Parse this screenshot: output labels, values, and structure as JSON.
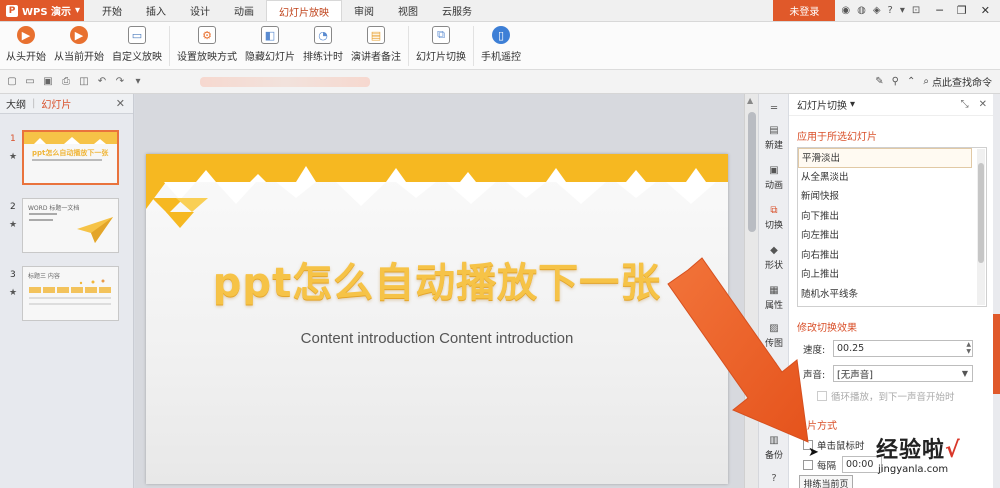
{
  "titlebar": {
    "app_name": "WPS 演示",
    "tabs": [
      "开始",
      "插入",
      "设计",
      "动画",
      "幻灯片放映",
      "审阅",
      "视图",
      "云服务"
    ],
    "active_tab": 4,
    "login_label": "未登录"
  },
  "ribbon": {
    "buttons": [
      {
        "label": "从头开始",
        "icon": "play-icon",
        "color": "#e8702f"
      },
      {
        "label": "从当前开始",
        "icon": "play-current-icon",
        "color": "#e8702f"
      },
      {
        "label": "自定义放映",
        "icon": "custom-show-icon",
        "color": "#4b7bbd"
      },
      {
        "label": "设置放映方式",
        "icon": "settings-icon",
        "color": "#7a7a7a"
      },
      {
        "label": "隐藏幻灯片",
        "icon": "hide-slide-icon",
        "color": "#5a8bd0"
      },
      {
        "label": "排练计时",
        "icon": "rehearse-timing-icon",
        "color": "#5a8bd0"
      },
      {
        "label": "演讲者备注",
        "icon": "speaker-notes-icon",
        "color": "#e8a02f"
      },
      {
        "label": "幻灯片切换",
        "icon": "slide-transition-icon",
        "color": "#5a8bd0"
      },
      {
        "label": "手机遥控",
        "icon": "phone-remote-icon",
        "color": "#3d7fd6"
      }
    ]
  },
  "quickbar": {
    "search_label": "点此查找命令"
  },
  "leftpane": {
    "tab_outline": "大纲",
    "tab_slides": "幻灯片",
    "slides": [
      {
        "num": "1",
        "star": "★",
        "title": "ppt怎么自动播放下一张"
      },
      {
        "num": "2",
        "star": "★",
        "title": "WORD 标题一文档"
      },
      {
        "num": "3",
        "star": "★",
        "title": "标题三 内容"
      }
    ]
  },
  "slide": {
    "title": "ppt怎么自动播放下一张",
    "subtitle": "Content introduction Content introduction"
  },
  "toolstrip": [
    {
      "label": "新建",
      "icon": "new-icon"
    },
    {
      "label": "动画",
      "icon": "animation-icon"
    },
    {
      "label": "切换",
      "icon": "transition-icon"
    },
    {
      "label": "形状",
      "icon": "shape-icon"
    },
    {
      "label": "属性",
      "icon": "properties-icon"
    },
    {
      "label": "传图",
      "icon": "upload-image-icon"
    },
    {
      "label": "",
      "icon": "location-icon"
    },
    {
      "label": "",
      "icon": "tool-icon"
    },
    {
      "label": "备份",
      "icon": "backup-icon"
    },
    {
      "label": "",
      "icon": "help-icon"
    }
  ],
  "panel": {
    "title": "幻灯片切换",
    "section_apply": "应用于所选幻灯片",
    "transitions": [
      "平滑淡出",
      "从全黑淡出",
      "新闻快报",
      "向下推出",
      "向左推出",
      "向右推出",
      "向上推出",
      "随机水平线条"
    ],
    "selected_transition": 0,
    "section_modify": "修改切换效果",
    "speed_label": "速度:",
    "speed_value": "00.25",
    "sound_label": "声音:",
    "sound_value": "[无声音]",
    "loop_label": "循环播放，到下一声音开始时",
    "section_advance": "换片方式",
    "on_click_label": "单击鼠标时",
    "every_label": "每隔",
    "every_value": "00:00",
    "apply_current_label": "排练当前页"
  },
  "watermark": {
    "main": "经验啦",
    "check": "√",
    "url": "jingyanla.com"
  },
  "colors": {
    "accent": "#e0592a",
    "slide_title": "#f6c347",
    "section": "#d9502a"
  }
}
